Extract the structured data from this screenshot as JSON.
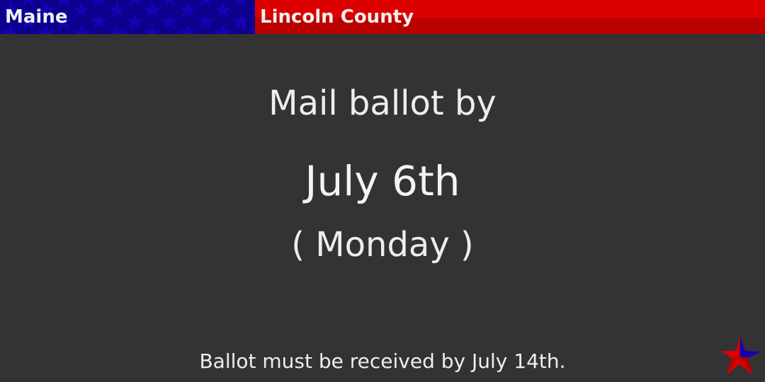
{
  "header": {
    "state": "Maine",
    "county": "Lincoln County"
  },
  "main": {
    "intro": "Mail ballot by",
    "date": "July 6th",
    "weekday": "( Monday )"
  },
  "footer": {
    "note": "Ballot must be received by July 14th."
  },
  "colors": {
    "blue": "#0c008e",
    "red": "#dd0000",
    "background": "#333333"
  },
  "icons": {
    "logo": "star-icon"
  }
}
